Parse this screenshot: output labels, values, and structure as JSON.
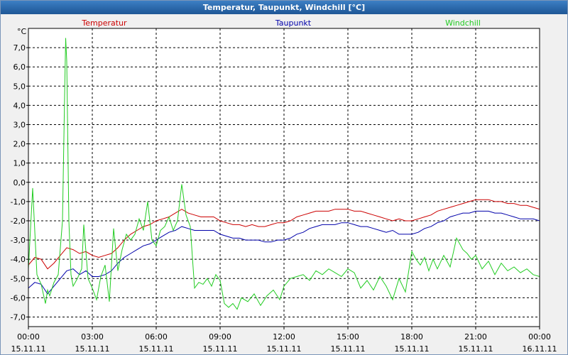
{
  "window": {
    "title": "Temperatur, Taupunkt, Windchill [°C]"
  },
  "colors": {
    "titlebar": "#2b68aa",
    "plot_bg": "#ffffff",
    "grid": "#000000"
  },
  "chart_data": {
    "type": "line",
    "unit": "°C",
    "grid": true,
    "legend_placement": "top",
    "ylim": [
      -7.5,
      8.0
    ],
    "ytick_labels": [
      "7,0",
      "6,0",
      "5,0",
      "4,0",
      "3,0",
      "2,0",
      "1,0",
      "0,0",
      "-1,0",
      "-2,0",
      "-3,0",
      "-4,0",
      "-5,0",
      "-6,0",
      "-7,0"
    ],
    "xticks": [
      {
        "time": "00:00",
        "date": "15.11.11"
      },
      {
        "time": "03:00",
        "date": "15.11.11"
      },
      {
        "time": "06:00",
        "date": "15.11.11"
      },
      {
        "time": "09:00",
        "date": "15.11.11"
      },
      {
        "time": "12:00",
        "date": "15.11.11"
      },
      {
        "time": "15:00",
        "date": "15.11.11"
      },
      {
        "time": "18:00",
        "date": "15.11.11"
      },
      {
        "time": "21:00",
        "date": "15.11.11"
      },
      {
        "time": "00:00",
        "date": "16.11.11"
      }
    ],
    "xlim_hours": [
      0,
      24
    ],
    "series": [
      {
        "name": "Temperatur",
        "color": "#cc0000",
        "x": [
          0,
          0.3,
          0.6,
          0.9,
          1.2,
          1.5,
          1.8,
          2.1,
          2.4,
          2.7,
          3.0,
          3.3,
          3.6,
          3.9,
          4.2,
          4.5,
          4.8,
          5.1,
          5.4,
          5.7,
          6.0,
          6.3,
          6.6,
          6.9,
          7.2,
          7.5,
          7.8,
          8.1,
          8.4,
          8.7,
          9.0,
          9.3,
          9.6,
          9.9,
          10.2,
          10.5,
          10.8,
          11.1,
          11.4,
          11.7,
          12.0,
          12.3,
          12.6,
          12.9,
          13.2,
          13.5,
          13.8,
          14.1,
          14.4,
          14.7,
          15.0,
          15.3,
          15.6,
          15.9,
          16.2,
          16.5,
          16.8,
          17.1,
          17.4,
          17.7,
          18.0,
          18.3,
          18.6,
          18.9,
          19.2,
          19.5,
          19.8,
          20.1,
          20.4,
          20.7,
          21.0,
          21.3,
          21.6,
          21.9,
          22.2,
          22.5,
          22.8,
          23.1,
          23.4,
          23.7,
          24.0
        ],
        "y": [
          -4.3,
          -3.9,
          -4.0,
          -4.5,
          -4.2,
          -3.8,
          -3.4,
          -3.5,
          -3.7,
          -3.6,
          -3.8,
          -3.9,
          -3.8,
          -3.7,
          -3.4,
          -3.0,
          -2.7,
          -2.5,
          -2.3,
          -2.2,
          -2.0,
          -1.9,
          -1.8,
          -1.6,
          -1.4,
          -1.6,
          -1.7,
          -1.8,
          -1.8,
          -1.8,
          -2.0,
          -2.1,
          -2.2,
          -2.2,
          -2.3,
          -2.2,
          -2.3,
          -2.3,
          -2.2,
          -2.1,
          -2.1,
          -2.0,
          -1.8,
          -1.7,
          -1.6,
          -1.5,
          -1.5,
          -1.5,
          -1.4,
          -1.4,
          -1.4,
          -1.5,
          -1.5,
          -1.6,
          -1.7,
          -1.8,
          -1.9,
          -2.0,
          -1.9,
          -2.0,
          -2.0,
          -1.9,
          -1.8,
          -1.7,
          -1.5,
          -1.4,
          -1.3,
          -1.2,
          -1.1,
          -1.0,
          -0.9,
          -0.9,
          -0.9,
          -1.0,
          -1.0,
          -1.1,
          -1.1,
          -1.2,
          -1.2,
          -1.3,
          -1.4
        ]
      },
      {
        "name": "Taupunkt",
        "color": "#0000aa",
        "x": [
          0,
          0.3,
          0.6,
          0.9,
          1.2,
          1.5,
          1.8,
          2.1,
          2.4,
          2.7,
          3.0,
          3.3,
          3.6,
          3.9,
          4.2,
          4.5,
          4.8,
          5.1,
          5.4,
          5.7,
          6.0,
          6.3,
          6.6,
          6.9,
          7.2,
          7.5,
          7.8,
          8.1,
          8.4,
          8.7,
          9.0,
          9.3,
          9.6,
          9.9,
          10.2,
          10.5,
          10.8,
          11.1,
          11.4,
          11.7,
          12.0,
          12.3,
          12.6,
          12.9,
          13.2,
          13.5,
          13.8,
          14.1,
          14.4,
          14.7,
          15.0,
          15.3,
          15.6,
          15.9,
          16.2,
          16.5,
          16.8,
          17.1,
          17.4,
          17.7,
          18.0,
          18.3,
          18.6,
          18.9,
          19.2,
          19.5,
          19.8,
          20.1,
          20.4,
          20.7,
          21.0,
          21.3,
          21.6,
          21.9,
          22.2,
          22.5,
          22.8,
          23.1,
          23.4,
          23.7,
          24.0
        ],
        "y": [
          -5.5,
          -5.2,
          -5.3,
          -5.8,
          -5.4,
          -5.0,
          -4.6,
          -4.5,
          -4.8,
          -4.6,
          -4.9,
          -4.9,
          -4.8,
          -4.6,
          -4.2,
          -3.9,
          -3.7,
          -3.5,
          -3.3,
          -3.2,
          -3.0,
          -2.8,
          -2.6,
          -2.5,
          -2.3,
          -2.4,
          -2.5,
          -2.5,
          -2.5,
          -2.5,
          -2.7,
          -2.8,
          -2.9,
          -2.9,
          -3.0,
          -3.0,
          -3.0,
          -3.1,
          -3.1,
          -3.0,
          -3.0,
          -2.9,
          -2.7,
          -2.6,
          -2.4,
          -2.3,
          -2.2,
          -2.2,
          -2.2,
          -2.1,
          -2.1,
          -2.2,
          -2.3,
          -2.3,
          -2.4,
          -2.5,
          -2.6,
          -2.5,
          -2.7,
          -2.7,
          -2.7,
          -2.6,
          -2.4,
          -2.3,
          -2.1,
          -2.0,
          -1.8,
          -1.7,
          -1.6,
          -1.6,
          -1.5,
          -1.5,
          -1.5,
          -1.6,
          -1.6,
          -1.7,
          -1.8,
          -1.9,
          -1.9,
          -1.9,
          -2.0
        ]
      },
      {
        "name": "Windchill",
        "color": "#22cc22",
        "x": [
          0,
          0.2,
          0.4,
          0.6,
          0.8,
          0.9,
          1.0,
          1.2,
          1.4,
          1.6,
          1.7,
          1.75,
          1.8,
          1.9,
          2.0,
          2.1,
          2.3,
          2.5,
          2.6,
          2.8,
          3.0,
          3.2,
          3.4,
          3.6,
          3.8,
          4.0,
          4.2,
          4.4,
          4.6,
          4.8,
          5.0,
          5.2,
          5.4,
          5.6,
          5.8,
          6.0,
          6.2,
          6.4,
          6.6,
          6.8,
          7.0,
          7.2,
          7.4,
          7.6,
          7.8,
          8.0,
          8.2,
          8.4,
          8.6,
          8.8,
          9.0,
          9.2,
          9.4,
          9.6,
          9.8,
          10.0,
          10.3,
          10.6,
          10.9,
          11.2,
          11.5,
          11.8,
          12.0,
          12.3,
          12.6,
          12.9,
          13.2,
          13.5,
          13.8,
          14.1,
          14.4,
          14.7,
          15.0,
          15.3,
          15.6,
          15.9,
          16.2,
          16.5,
          16.8,
          17.1,
          17.4,
          17.7,
          18.0,
          18.2,
          18.4,
          18.6,
          18.8,
          19.0,
          19.2,
          19.5,
          19.8,
          20.1,
          20.4,
          20.6,
          20.8,
          21.0,
          21.3,
          21.6,
          21.9,
          22.2,
          22.5,
          22.8,
          23.1,
          23.4,
          23.7,
          24.0
        ],
        "y": [
          -4.5,
          -0.3,
          -4.8,
          -5.3,
          -6.3,
          -5.6,
          -5.9,
          -5.2,
          -4.8,
          -2.0,
          4.5,
          7.5,
          6.3,
          -2.0,
          -4.8,
          -5.4,
          -5.0,
          -4.5,
          -2.2,
          -5.0,
          -5.5,
          -6.1,
          -4.9,
          -4.3,
          -6.2,
          -2.4,
          -4.6,
          -3.5,
          -2.7,
          -3.0,
          -2.7,
          -1.9,
          -2.5,
          -1.0,
          -3.0,
          -3.3,
          -2.5,
          -2.3,
          -1.8,
          -2.5,
          -2.0,
          -0.1,
          -1.7,
          -2.3,
          -5.5,
          -5.2,
          -5.3,
          -5.0,
          -5.4,
          -4.8,
          -5.1,
          -6.3,
          -6.5,
          -6.3,
          -6.6,
          -6.0,
          -6.2,
          -5.8,
          -6.4,
          -5.9,
          -5.6,
          -6.1,
          -5.4,
          -5.0,
          -4.9,
          -4.8,
          -5.1,
          -4.6,
          -4.8,
          -4.5,
          -4.7,
          -4.9,
          -4.5,
          -4.7,
          -5.5,
          -5.1,
          -5.6,
          -4.9,
          -5.4,
          -6.1,
          -5.0,
          -5.7,
          -3.6,
          -4.0,
          -4.3,
          -3.9,
          -4.6,
          -4.0,
          -4.5,
          -3.8,
          -4.4,
          -2.9,
          -3.5,
          -3.7,
          -4.0,
          -3.8,
          -4.5,
          -4.1,
          -4.8,
          -4.2,
          -4.6,
          -4.4,
          -4.7,
          -4.5,
          -4.8,
          -4.9
        ]
      }
    ]
  }
}
